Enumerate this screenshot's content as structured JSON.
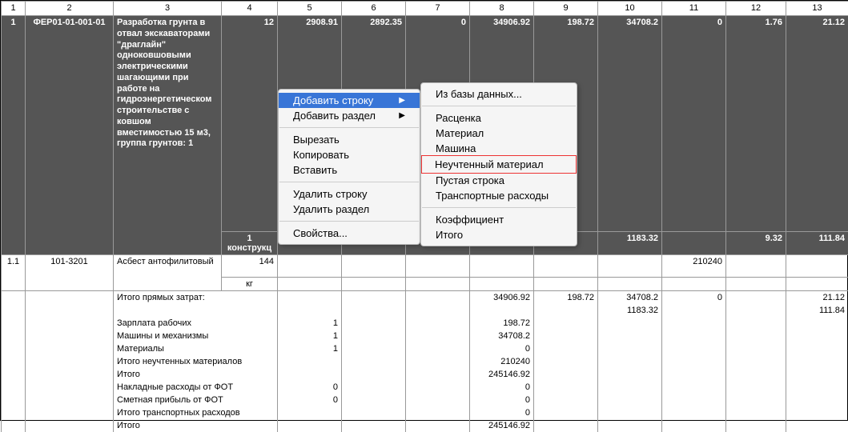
{
  "headers": [
    "1",
    "2",
    "3",
    "4",
    "5",
    "6",
    "7",
    "8",
    "9",
    "10",
    "11",
    "12",
    "13"
  ],
  "row1": {
    "c1": "1",
    "c2": "ФЕР01-01-001-01",
    "c3": "Разработка грунта в отвал экскаваторами \"драглайн\" одноковшовыми электрическими шагающими при работе на гидроэнергетическом строительстве с ковшом вместимостью 15 м3, группа грунтов: 1",
    "c4": "12",
    "c5": "2908.91",
    "c6": "2892.35",
    "c7": "0",
    "c8": "34906.92",
    "c9": "198.72",
    "c10": "34708.2",
    "c11": "0",
    "c12": "1.76",
    "c13": "21.12"
  },
  "row1b": {
    "c4": "1 конструкц",
    "c10": "1183.32",
    "c12": "9.32",
    "c13": "111.84"
  },
  "row2": {
    "c1": "1.1",
    "c2": "101-3201",
    "c3": "Асбест антофилитовый",
    "c4": "144",
    "c11": "210240"
  },
  "row2b": {
    "c4": "кг"
  },
  "summary": [
    {
      "label": "Итого прямых затрат:",
      "c5": "",
      "c8": "34906.92",
      "c9": "198.72",
      "c10": "34708.2",
      "c11": "0",
      "c13": "21.12"
    },
    {
      "label": "",
      "c10": "1183.32",
      "c13": "111.84"
    },
    {
      "label": "Зарплата рабочих",
      "c5": "1",
      "c8": "198.72"
    },
    {
      "label": "Машины и механизмы",
      "c5": "1",
      "c8": "34708.2"
    },
    {
      "label": "Материалы",
      "c5": "1",
      "c8": "0"
    },
    {
      "label": "Итого неучтенных материалов",
      "c8": "210240"
    },
    {
      "label": "Итого",
      "c8": "245146.92"
    },
    {
      "label": "Накладные расходы от ФОТ",
      "c5": "0",
      "c8": "0"
    },
    {
      "label": "Сметная прибыль от ФОТ",
      "c5": "0",
      "c8": "0"
    },
    {
      "label": "Итого транспортных расходов",
      "c8": "0"
    },
    {
      "label": "Итого",
      "c8": "245146.92"
    }
  ],
  "menu": {
    "main": [
      {
        "label": "Добавить строку",
        "arrow": true,
        "sel": true
      },
      {
        "label": "Добавить раздел",
        "arrow": true
      },
      {
        "sep": true
      },
      {
        "label": "Вырезать"
      },
      {
        "label": "Копировать"
      },
      {
        "label": "Вставить"
      },
      {
        "sep": true
      },
      {
        "label": "Удалить строку"
      },
      {
        "label": "Удалить раздел"
      },
      {
        "sep": true
      },
      {
        "label": "Свойства..."
      }
    ],
    "sub": [
      {
        "label": "Из базы данных..."
      },
      {
        "sep": true
      },
      {
        "label": "Расценка"
      },
      {
        "label": "Материал"
      },
      {
        "label": "Машина"
      },
      {
        "label": "Неучтенный материал",
        "hl": true
      },
      {
        "label": "Пустая строка"
      },
      {
        "label": "Транспортные расходы"
      },
      {
        "sep": true
      },
      {
        "label": "Коэффициент"
      },
      {
        "label": "Итого"
      }
    ]
  }
}
